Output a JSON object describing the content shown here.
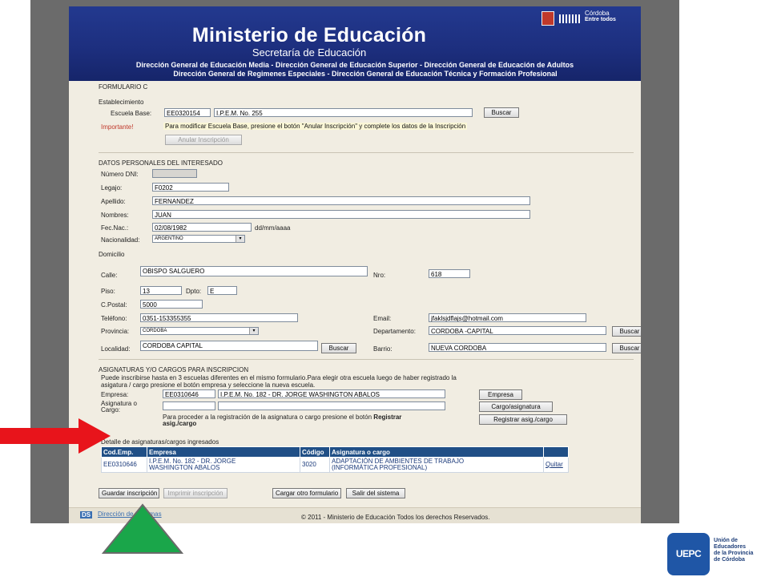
{
  "banner": {
    "title": "Ministerio de Educación",
    "subtitle": "Secretaría de Educación",
    "dir_line1": "Dirección General de Educación Media - Dirección General de Educación Superior - Dirección General de Educación de Adultos",
    "dir_line2": "Dirección General de Regimenes Especiales - Dirección General de Educación Técnica y Formación Profesional",
    "logo_line1": "Córdoba",
    "logo_line2": "Entre todos"
  },
  "form": {
    "title": "FORMULARIO C",
    "establecimiento": {
      "section": "Establecimiento",
      "escuela_base_label": "Escuela Base:",
      "escuela_code": "EE0320154",
      "escuela_name": "I.P.E.M. No. 255",
      "buscar": "Buscar",
      "importante": "Importante!",
      "note": "Para modificar Escuela Base, presione el botón \"Anular Inscripción\" y complete los datos de la Inscripción",
      "anular": "Anular Inscripción"
    },
    "personales": {
      "section": "DATOS PERSONALES DEL INTERESADO",
      "dni_label": "Número DNI:",
      "dni_value": "",
      "legajo_label": "Legajo:",
      "legajo_value": "F0202",
      "apellido_label": "Apellido:",
      "apellido_value": "FERNANDEZ",
      "nombres_label": "Nombres:",
      "nombres_value": "JUAN",
      "fecnac_label": "Fec.Nac.:",
      "fecnac_value": "02/08/1982",
      "fecnac_hint": "dd/mm/aaaa",
      "nacionalidad_label": "Nacionalidad:",
      "nacionalidad_value": "ARGENTINO"
    },
    "domicilio": {
      "section": "Domicilio",
      "calle_label": "Calle:",
      "calle_value": "OBISPO SALGUERO",
      "nro_label": "Nro:",
      "nro_value": "618",
      "piso_label": "Piso:",
      "piso_value": "13",
      "dpto_label": "Dpto:",
      "dpto_value": "E",
      "cpostal_label": "C.Postal:",
      "cpostal_value": "5000",
      "telefono_label": "Teléfono:",
      "telefono_value": "0351-153355355",
      "email_label": "Email:",
      "email_value": "jfaklsjdflajs@hotmail.com",
      "provincia_label": "Provincia:",
      "provincia_value": "CORDOBA",
      "departamento_label": "Departamento:",
      "departamento_value": "CORDOBA -CAPITAL",
      "localidad_label": "Localidad:",
      "localidad_value": "CORDOBA CAPITAL",
      "barrio_label": "Barrio:",
      "barrio_value": "NUEVA CORDOBA",
      "buscar": "Buscar"
    },
    "asignaturas": {
      "section": "ASIGNATURAS Y/O CARGOS PARA INSCRIPCION",
      "info_line1": "Puede inscribirse hasta en 3 escuelas diferentes en el mismo formulario.Para elegir otra escuela  luego de haber registrado la",
      "info_line2": "asigatura / cargo presione el botón empresa y seleccione la nueva escuela.",
      "empresa_label": "Empresa:",
      "empresa_code": "EE0310646",
      "empresa_name": "I.P.E.M. No. 182 - DR. JORGE WASHINGTON ABALOS",
      "asig_label1": "Asignatura o",
      "asig_label2": "Cargo:",
      "asig_code": "",
      "asig_name": "",
      "proceder_text": "Para proceder a la registración de la asignatura o cargo presione el botón",
      "proceder_bold1": "Registrar",
      "proceder_bold2": "asig./cargo",
      "btn_empresa": "Empresa",
      "btn_cargo": "Cargo/asignatura",
      "btn_registrar": "Registrar asig./cargo"
    },
    "detalle": {
      "section": "Detalle de asignaturas/cargos ingresados",
      "headers": [
        "Cod.Emp.",
        "Empresa",
        "Código",
        "Asignatura o cargo",
        ""
      ],
      "rows": [
        {
          "cod": "EE0310646",
          "empresa1": "I.P.E.M. No. 182 - DR. JORGE",
          "empresa2": "WASHINGTON ABALOS",
          "codigo": "3020",
          "asig1": "ADAPTACIÓN DE AMBIENTES DE TRABAJO",
          "asig2": "(INFORMÁTICA PROFESIONAL)",
          "accion": "Quitar"
        }
      ]
    },
    "actions": {
      "guardar": "Guardar inscripción",
      "imprimir": "Imprimir inscripción",
      "cargar": "Cargar otro formulario",
      "salir": "Salir del sistema"
    }
  },
  "footer": {
    "ds": "DS",
    "link": "Dirección de Sistemas",
    "copyright": "© 2011 - Ministerio de Educación Todos los derechos Reservados."
  },
  "annotations": {
    "arrow_color": "#e8141b",
    "triangle_color": "#1aa64a"
  },
  "uepc": {
    "badge": "UEPC",
    "line1": "Unión de",
    "line2": "Educadores",
    "line3": "de la Provincia",
    "line4": "de Córdoba"
  }
}
